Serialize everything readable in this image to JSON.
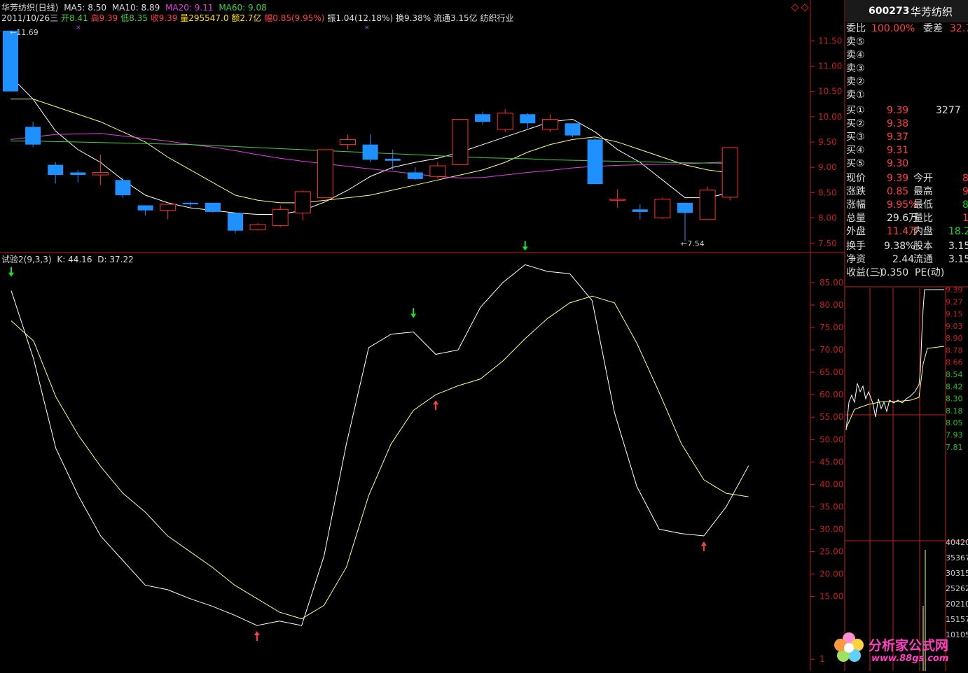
{
  "header": {
    "stock_title": "华芳纺织(日线)",
    "ma5": "MA5: 8.50",
    "ma10": "MA10: 8.89",
    "ma20": "MA20: 9.11",
    "ma60": "MA60: 9.08",
    "date": "2011/10/26三",
    "open": "开8.41",
    "high": "高9.39",
    "low": "低8.35",
    "close": "收9.39",
    "volume": "量295547.0",
    "amount": "额2.7亿",
    "change": "幅0.85(9.95%)",
    "amplitude": "振1.04(12.18%)",
    "turnover": "换9.38%",
    "float": "流通3.15亿",
    "industry": "纺织行业"
  },
  "kline": {
    "high_label": "11.69",
    "low_label": "7.54",
    "axis_ticks": [
      "11.50",
      "11.00",
      "10.50",
      "10.00",
      "9.50",
      "9.00",
      "8.50",
      "8.00",
      "7.50"
    ]
  },
  "indicator": {
    "title": "试验2(9,3,3)",
    "k_label": "K: 44.16",
    "d_label": "D: 37.22",
    "axis_ticks": [
      "85.00",
      "80.00",
      "75.00",
      "70.00",
      "65.00",
      "60.00",
      "55.00",
      "50.00",
      "45.00",
      "40.00",
      "35.00",
      "30.00",
      "25.00",
      "20.00",
      "15.00",
      "1"
    ]
  },
  "side_panel": {
    "code": "600273",
    "name": "华芳纺织",
    "weibi_label": "委比",
    "weibi": "100.00%",
    "weicha_label": "委差",
    "weicha": "32.78",
    "sell_labels": [
      "卖⑤",
      "卖④",
      "卖③",
      "卖②",
      "卖①"
    ],
    "buy": [
      {
        "label": "买①",
        "price": "9.39",
        "vol": "3277"
      },
      {
        "label": "买②",
        "price": "9.38",
        "vol": ""
      },
      {
        "label": "买③",
        "price": "9.37",
        "vol": ""
      },
      {
        "label": "买④",
        "price": "9.31",
        "vol": ""
      },
      {
        "label": "买⑤",
        "price": "9.30",
        "vol": ""
      }
    ],
    "stats": [
      {
        "l1": "现价",
        "v1": "9.39",
        "l2": "今开",
        "v2": "8."
      },
      {
        "l1": "涨跌",
        "v1": "0.85",
        "l2": "最高",
        "v2": "9."
      },
      {
        "l1": "涨幅",
        "v1": "9.95%",
        "l2": "最低",
        "v2": "8."
      },
      {
        "l1": "总量",
        "v1": "29.6万",
        "l2": "量比",
        "v2": "1."
      },
      {
        "l1": "外盘",
        "v1": "11.4万",
        "l2": "内盘",
        "v2": "18.2"
      },
      {
        "l1": "换手",
        "v1": "9.38%",
        "l2": "股本",
        "v2": "3.15"
      },
      {
        "l1": "净资",
        "v1": "2.44",
        "l2": "流通",
        "v2": "3.15"
      },
      {
        "l1": "收益(三)",
        "v1": "-0.350",
        "l2": "PE(动)",
        "v2": ""
      }
    ],
    "intraday_ticks": [
      "9.39",
      "9.27",
      "9.15",
      "9.03",
      "8.90",
      "8.78",
      "8.66",
      "8.54",
      "8.42",
      "8.30",
      "8.18",
      "8.05",
      "7.93",
      "7.81"
    ],
    "volume_ticks": [
      "40420",
      "35367",
      "30315",
      "25262",
      "20210",
      "15157",
      "10105"
    ]
  },
  "watermark": {
    "site_name": "分析家公式网",
    "site_url": "www.88gs.com"
  },
  "chart_data": [
    {
      "type": "candlestick",
      "title": "华芳纺织(日线)",
      "ylim": [
        7.4,
        11.85
      ],
      "candles": [
        {
          "o": 11.7,
          "c": 10.5,
          "h": 11.7,
          "l": 10.5
        },
        {
          "o": 9.8,
          "c": 9.45,
          "h": 9.9,
          "l": 9.4
        },
        {
          "o": 9.05,
          "c": 8.85,
          "h": 9.1,
          "l": 8.68
        },
        {
          "o": 8.9,
          "c": 8.85,
          "h": 8.95,
          "l": 8.7
        },
        {
          "o": 8.85,
          "c": 8.9,
          "h": 9.25,
          "l": 8.65
        },
        {
          "o": 8.75,
          "c": 8.45,
          "h": 8.8,
          "l": 8.4
        },
        {
          "o": 8.25,
          "c": 8.15,
          "h": 8.25,
          "l": 8.05
        },
        {
          "o": 8.15,
          "c": 8.27,
          "h": 8.27,
          "l": 7.97
        },
        {
          "o": 8.3,
          "c": 8.27,
          "h": 8.32,
          "l": 8.2
        },
        {
          "o": 8.3,
          "c": 8.12,
          "h": 8.3,
          "l": 8.1
        },
        {
          "o": 8.1,
          "c": 7.75,
          "h": 8.1,
          "l": 7.7
        },
        {
          "o": 7.77,
          "c": 7.87,
          "h": 7.9,
          "l": 7.75
        },
        {
          "o": 7.85,
          "c": 8.17,
          "h": 8.25,
          "l": 7.82
        },
        {
          "o": 8.1,
          "c": 8.52,
          "h": 8.55,
          "l": 7.95
        },
        {
          "o": 8.4,
          "c": 9.35,
          "h": 9.35,
          "l": 8.4
        },
        {
          "o": 9.45,
          "c": 9.55,
          "h": 9.65,
          "l": 9.35
        },
        {
          "o": 9.45,
          "c": 9.15,
          "h": 9.65,
          "l": 9.1
        },
        {
          "o": 9.17,
          "c": 9.13,
          "h": 9.35,
          "l": 8.95
        },
        {
          "o": 8.9,
          "c": 8.77,
          "h": 9.0,
          "l": 8.75
        },
        {
          "o": 8.82,
          "c": 9.03,
          "h": 9.1,
          "l": 8.78
        },
        {
          "o": 9.05,
          "c": 9.95,
          "h": 9.95,
          "l": 9.05
        },
        {
          "o": 10.05,
          "c": 9.9,
          "h": 10.1,
          "l": 9.85
        },
        {
          "o": 9.75,
          "c": 10.07,
          "h": 10.15,
          "l": 9.7
        },
        {
          "o": 10.05,
          "c": 9.87,
          "h": 10.07,
          "l": 9.77
        },
        {
          "o": 9.75,
          "c": 9.95,
          "h": 10.05,
          "l": 9.7
        },
        {
          "o": 9.87,
          "c": 9.63,
          "h": 9.87,
          "l": 9.6
        },
        {
          "o": 9.55,
          "c": 8.67,
          "h": 9.58,
          "l": 8.67
        },
        {
          "o": 8.37,
          "c": 8.37,
          "h": 8.57,
          "l": 8.2
        },
        {
          "o": 8.17,
          "c": 8.12,
          "h": 8.27,
          "l": 7.97
        },
        {
          "o": 8.0,
          "c": 8.37,
          "h": 8.4,
          "l": 7.98
        },
        {
          "o": 8.3,
          "c": 8.1,
          "h": 8.3,
          "l": 7.54
        },
        {
          "o": 7.97,
          "c": 8.55,
          "h": 8.62,
          "l": 7.97
        },
        {
          "o": 8.41,
          "c": 9.39,
          "h": 9.39,
          "l": 8.35
        }
      ],
      "series": [
        {
          "name": "MA5",
          "values": [
            10.8,
            10.35,
            9.72,
            9.35,
            9.1,
            8.75,
            8.45,
            8.3,
            8.2,
            8.15,
            8.1,
            8.07,
            8.07,
            8.15,
            8.32,
            8.55,
            8.82,
            9.0,
            9.1,
            9.18,
            9.3,
            9.45,
            9.6,
            9.75,
            9.9,
            9.95,
            9.7,
            9.35,
            9.1,
            8.75,
            8.4,
            8.4,
            8.5
          ]
        },
        {
          "name": "MA10",
          "values": [
            10.35,
            10.35,
            10.2,
            10.05,
            9.9,
            9.7,
            9.5,
            9.2,
            8.95,
            8.7,
            8.45,
            8.35,
            8.3,
            8.3,
            8.35,
            8.4,
            8.45,
            8.55,
            8.65,
            8.75,
            8.85,
            8.95,
            9.1,
            9.3,
            9.45,
            9.55,
            9.6,
            9.5,
            9.35,
            9.2,
            9.05,
            8.95,
            8.89
          ]
        },
        {
          "name": "MA20",
          "values": [
            9.55,
            9.6,
            9.65,
            9.66,
            9.67,
            9.62,
            9.57,
            9.52,
            9.45,
            9.4,
            9.33,
            9.25,
            9.18,
            9.12,
            9.07,
            9.02,
            8.97,
            8.92,
            8.87,
            8.82,
            8.79,
            8.8,
            8.85,
            8.9,
            8.94,
            8.99,
            9.02,
            9.04,
            9.05,
            9.06,
            9.07,
            9.09,
            9.11
          ]
        },
        {
          "name": "MA60",
          "values": [
            9.52,
            9.52,
            9.51,
            9.5,
            9.49,
            9.48,
            9.47,
            9.46,
            9.45,
            9.43,
            9.41,
            9.39,
            9.37,
            9.35,
            9.33,
            9.31,
            9.29,
            9.27,
            9.25,
            9.23,
            9.21,
            9.19,
            9.18,
            9.17,
            9.15,
            9.14,
            9.13,
            9.12,
            9.11,
            9.1,
            9.09,
            9.085,
            9.08
          ]
        }
      ]
    },
    {
      "type": "line",
      "title": "试验2(9,3,3)",
      "ylim": [
        -1,
        90
      ],
      "series": [
        {
          "name": "K",
          "values": [
            83.2,
            68,
            48,
            37.5,
            28.5,
            23,
            17.5,
            16.5,
            14.5,
            12.8,
            10.8,
            8.5,
            9.5,
            8.5,
            24,
            49,
            70.5,
            73.5,
            74,
            69,
            70,
            79.5,
            85,
            89,
            87.5,
            87,
            81,
            56,
            39.5,
            30,
            29,
            28.5,
            35,
            44.16
          ]
        },
        {
          "name": "D",
          "values": [
            76.5,
            72,
            59.5,
            51,
            44,
            38,
            33.8,
            28.5,
            25,
            21.5,
            17.5,
            14.5,
            11.5,
            10,
            13,
            21.5,
            37.5,
            49,
            56.5,
            60,
            62,
            63.5,
            67.5,
            72.5,
            77,
            80.5,
            82,
            80.5,
            71.5,
            60.5,
            49,
            41,
            38,
            37.22
          ]
        }
      ],
      "signals": [
        {
          "index": 0,
          "type": "down"
        },
        {
          "index": 11,
          "type": "up"
        },
        {
          "index": 18,
          "type": "down"
        },
        {
          "index": 19,
          "type": "up"
        },
        {
          "index": 23,
          "type": "down"
        },
        {
          "index": 31,
          "type": "up"
        }
      ]
    }
  ]
}
